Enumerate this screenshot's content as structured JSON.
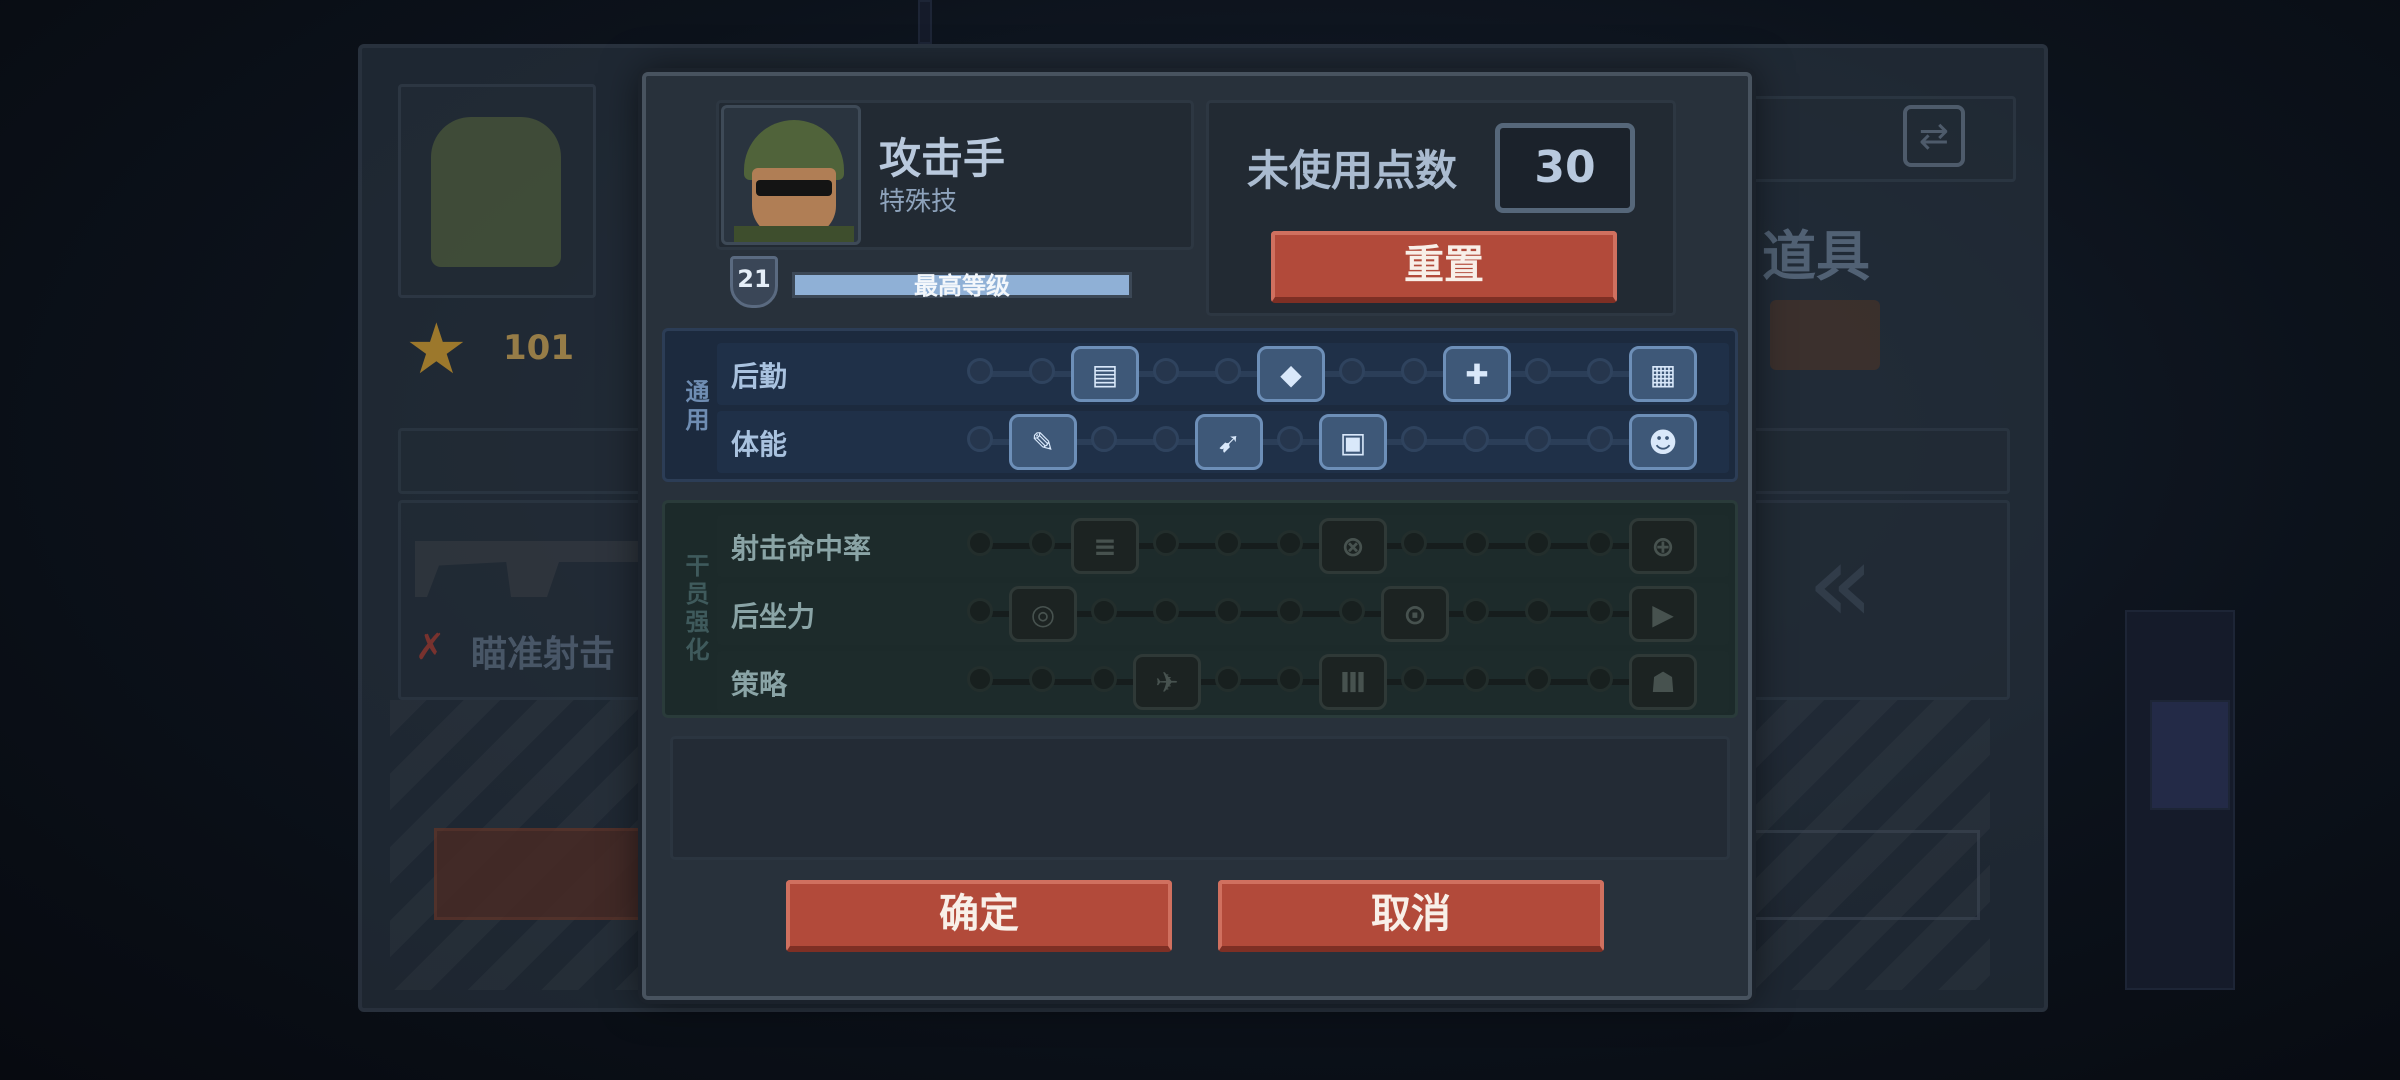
{
  "background": {
    "star_count": "101",
    "weapon_skill_label": "瞄准射击",
    "items_title": "道具",
    "swap_icon": "swap-icon",
    "chevron_icon": "double-chevron-left-icon"
  },
  "character": {
    "name": "攻击手",
    "subtitle": "特殊技",
    "level": "21",
    "level_text": "最高等级",
    "level_progress": 1.0
  },
  "points": {
    "label": "未使用点数",
    "value": "30"
  },
  "buttons": {
    "reset": "重置",
    "confirm": "确定",
    "cancel": "取消"
  },
  "sections": {
    "general": {
      "tag": "通用",
      "rows": [
        {
          "label": "后勤",
          "skills": [
            {
              "glyph": "▤",
              "icon": "ammo-belt-icon"
            },
            {
              "glyph": "◆",
              "icon": "armor-plus-icon"
            },
            {
              "glyph": "✚",
              "icon": "medkit-icon"
            },
            {
              "glyph": "▦",
              "icon": "supply-crate-icon"
            }
          ]
        },
        {
          "label": "体能",
          "skills": [
            {
              "glyph": "✎",
              "icon": "knife-icon"
            },
            {
              "glyph": "➹",
              "icon": "sprint-icon"
            },
            {
              "glyph": "▣",
              "icon": "backpack-icon"
            },
            {
              "glyph": "☻",
              "icon": "fist-icon"
            }
          ]
        }
      ]
    },
    "specialist": {
      "tag": "干员强化",
      "rows": [
        {
          "label": "射击命中率",
          "skills": [
            {
              "glyph": "≡",
              "icon": "bullets-icon"
            },
            {
              "glyph": "⊗",
              "icon": "double-target-icon"
            },
            {
              "glyph": "⊕",
              "icon": "crosshair-icon"
            }
          ]
        },
        {
          "label": "后坐力",
          "skills": [
            {
              "glyph": "◎",
              "icon": "grip-icon"
            },
            {
              "glyph": "⊙",
              "icon": "muzzle-icon"
            },
            {
              "glyph": "▶",
              "icon": "barrel-icon"
            }
          ]
        },
        {
          "label": "策略",
          "skills": [
            {
              "glyph": "✈",
              "icon": "airstrike-icon"
            },
            {
              "glyph": "Ⅲ",
              "icon": "claws-icon"
            },
            {
              "glyph": "☗",
              "icon": "wave-icon"
            }
          ]
        }
      ]
    }
  },
  "colors": {
    "accent_red": "#b24a3a",
    "section_blue": "#1c2a3e",
    "section_green": "#1c2a2a",
    "skill_unlocked": "#3e5878"
  }
}
